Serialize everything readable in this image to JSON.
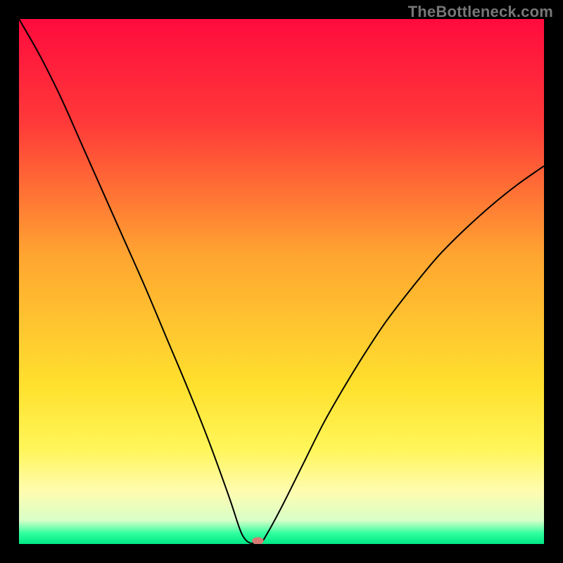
{
  "watermark": "TheBottleneck.com",
  "chart_data": {
    "type": "line",
    "title": "",
    "xlabel": "",
    "ylabel": "",
    "xlim": [
      0,
      100
    ],
    "ylim": [
      0,
      100
    ],
    "legend": false,
    "grid": false,
    "background": {
      "type": "vertical-gradient",
      "stops": [
        {
          "pos": 0.0,
          "color": "#ff0b3d"
        },
        {
          "pos": 0.2,
          "color": "#ff3a39"
        },
        {
          "pos": 0.45,
          "color": "#ffa531"
        },
        {
          "pos": 0.7,
          "color": "#ffe12e"
        },
        {
          "pos": 0.82,
          "color": "#fff65a"
        },
        {
          "pos": 0.9,
          "color": "#fffcb0"
        },
        {
          "pos": 0.955,
          "color": "#d8ffc8"
        },
        {
          "pos": 0.98,
          "color": "#2fff9e"
        },
        {
          "pos": 1.0,
          "color": "#00e884"
        }
      ]
    },
    "series": [
      {
        "name": "bottleneck-curve",
        "color": "#000000",
        "stroke_width": 2,
        "x": [
          0,
          4,
          8,
          12,
          16,
          20,
          24,
          28,
          32,
          36,
          40,
          42,
          43,
          44,
          45,
          46,
          47,
          50,
          54,
          58,
          62,
          66,
          70,
          75,
          80,
          85,
          90,
          95,
          100
        ],
        "values": [
          100,
          93,
          85,
          76,
          67,
          58,
          49,
          39.5,
          30,
          20,
          9,
          3,
          1,
          0.2,
          0.2,
          0.2,
          1.5,
          7,
          15,
          23,
          30,
          36.5,
          42.5,
          49,
          55,
          60,
          64.5,
          68.5,
          72
        ]
      }
    ],
    "marker": {
      "name": "optimum-point",
      "x": 45.5,
      "y": 0.6,
      "color": "#d87a74",
      "rx": 1.1,
      "ry": 0.7
    }
  }
}
